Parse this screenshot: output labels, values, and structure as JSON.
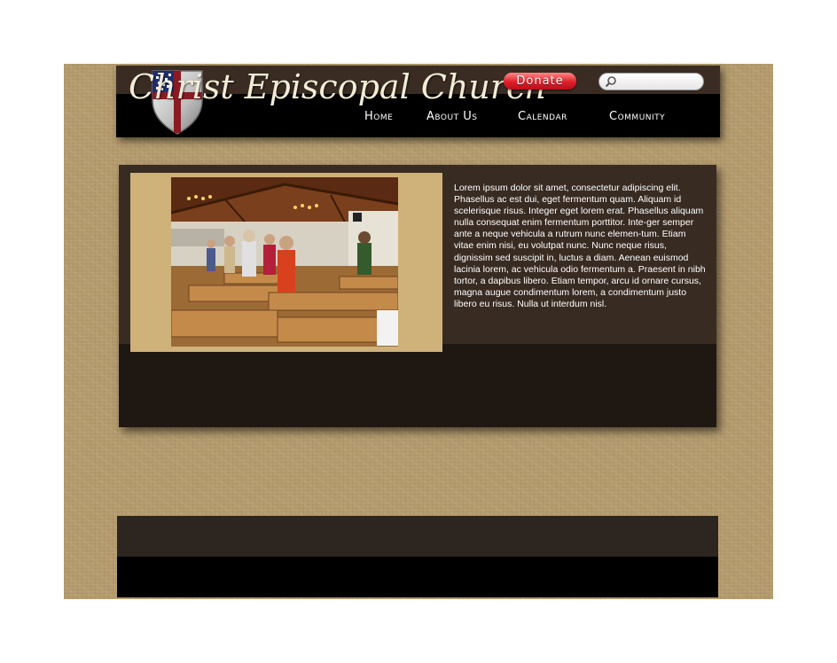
{
  "site": {
    "logo_text": "Christ Episcopal Church"
  },
  "header": {
    "donate_label": "Donate",
    "search_placeholder": "",
    "nav": [
      {
        "label": "Home"
      },
      {
        "label": "About Us"
      },
      {
        "label": "Calendar"
      },
      {
        "label": "Community"
      }
    ]
  },
  "main": {
    "body_text": "Lorem ipsum dolor sit amet, consectetur adipiscing elit. Phasellus ac est dui, eget fermentum quam. Aliquam id scelerisque risus. Integer eget lorem erat. Phasellus aliquam nulla consequat enim fermentum porttitor. Inte-ger semper ante a neque vehicula a rutrum nunc elemen-tum.  Etiam vitae enim nisi, eu volutpat nunc. Nunc neque risus, dignissim sed suscipit in, luctus a diam. Aenean euismod lacinia lorem, ac vehicula odio fermentum a. Praesent in nibh tortor, a dapibus libero. Etiam tempor, arcu id ornare cursus, magna augue condimentum lorem, a condimentum justo libero eu risus. Nulla ut interdum nisl."
  },
  "icons": {
    "search": "search-icon",
    "shield": "episcopal-shield-icon"
  },
  "colors": {
    "background": "#b39a6c",
    "header_top": "#3a2c22",
    "header_bottom": "#000000",
    "panel": "#382b22",
    "panel_lower": "#1f1712",
    "photo_frame": "#cfb17a",
    "donate": "#e01f2a"
  }
}
